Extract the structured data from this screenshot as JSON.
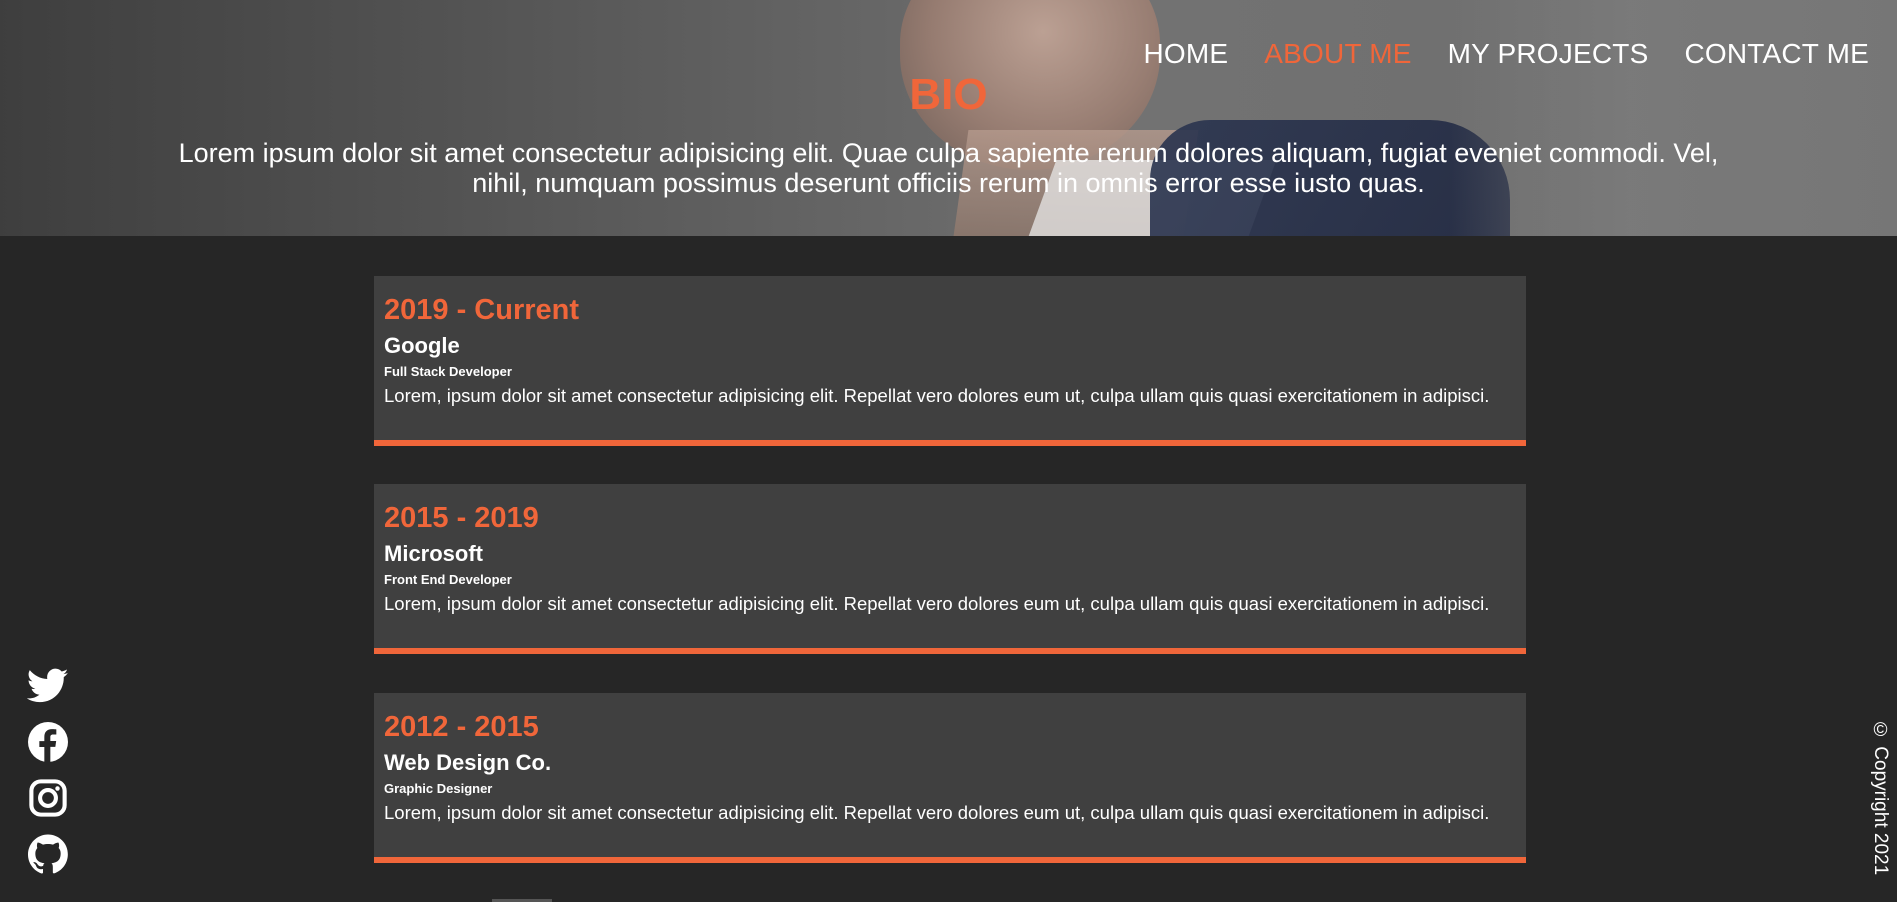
{
  "nav": {
    "items": [
      {
        "label": "HOME",
        "active": false
      },
      {
        "label": "ABOUT ME",
        "active": true
      },
      {
        "label": "MY PROJECTS",
        "active": false
      },
      {
        "label": "CONTACT ME",
        "active": false
      }
    ]
  },
  "hero": {
    "title": "BIO",
    "text": "Lorem ipsum dolor sit amet consectetur adipisicing elit. Quae culpa sapiente rerum dolores aliquam, fugiat eveniet commodi. Vel, nihil, numquam possimus deserunt officiis rerum in omnis error esse iusto quas."
  },
  "timeline": [
    {
      "period": "2019 - Current",
      "company": "Google",
      "role": "Full Stack Developer",
      "description": "Lorem, ipsum dolor sit amet consectetur adipisicing elit. Repellat vero dolores eum ut, culpa ullam quis quasi exercitationem in adipisci."
    },
    {
      "period": "2015 - 2019",
      "company": "Microsoft",
      "role": "Front End Developer",
      "description": "Lorem, ipsum dolor sit amet consectetur adipisicing elit. Repellat vero dolores eum ut, culpa ullam quis quasi exercitationem in adipisci."
    },
    {
      "period": "2012 - 2015",
      "company": "Web Design Co.",
      "role": "Graphic Designer",
      "description": "Lorem, ipsum dolor sit amet consectetur adipisicing elit. Repellat vero dolores eum ut, culpa ullam quis quasi exercitationem in adipisci."
    }
  ],
  "social": [
    "twitter-icon",
    "facebook-icon",
    "instagram-icon",
    "github-icon"
  ],
  "footer": {
    "copyright": "© Copyright 2021"
  },
  "colors": {
    "accent": "#f0663a",
    "background": "#262626",
    "card": "#404040"
  }
}
